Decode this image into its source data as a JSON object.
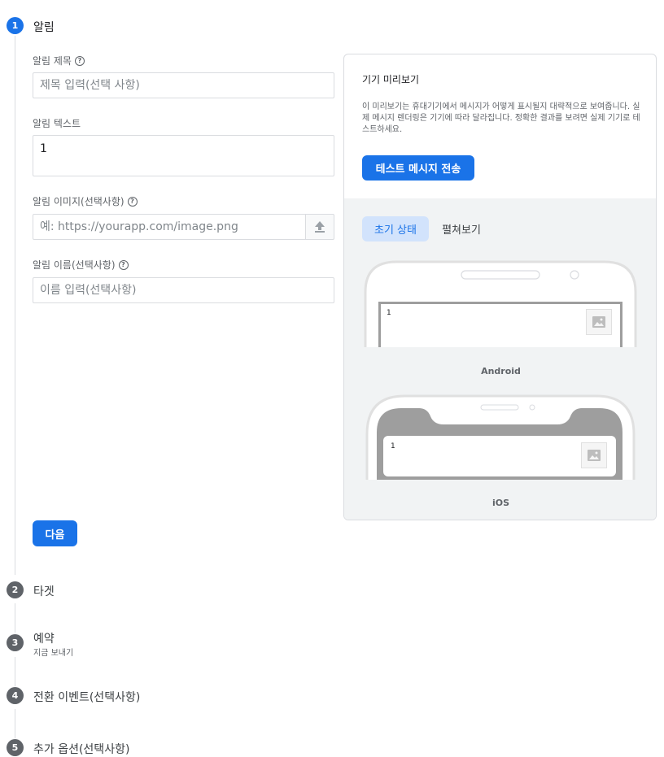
{
  "steps": [
    {
      "number": "1",
      "title": "알림"
    },
    {
      "number": "2",
      "title": "타겟"
    },
    {
      "number": "3",
      "title": "예약",
      "subtitle": "지금 보내기"
    },
    {
      "number": "4",
      "title": "전환 이벤트(선택사항)"
    },
    {
      "number": "5",
      "title": "추가 옵션(선택사항)"
    }
  ],
  "form": {
    "title_label": "알림 제목",
    "title_placeholder": "제목 입력(선택 사항)",
    "text_label": "알림 텍스트",
    "text_value": "1",
    "image_label": "알림 이미지(선택사항)",
    "image_placeholder": "예: https://yourapp.com/image.png",
    "name_label": "알림 이름(선택사항)",
    "name_placeholder": "이름 입력(선택사항)",
    "next_button": "다음"
  },
  "preview": {
    "title": "기기 미리보기",
    "description": "이 미리보기는 휴대기기에서 메시지가 어떻게 표시될지 대략적으로 보여줍니다. 실제 메시지 렌더링은 기기에 따라 달라집니다. 정확한 결과를 보려면 실제 기기로 테스트하세요.",
    "test_button": "테스트 메시지 전송",
    "tabs": [
      "초기 상태",
      "펼쳐보기"
    ],
    "selected_tab": "초기 상태",
    "android_label": "Android",
    "ios_label": "iOS",
    "notification_text": "1"
  },
  "icons": {
    "help": "help-circle-icon",
    "upload": "upload-icon",
    "image": "image-icon"
  },
  "colors": {
    "primary": "#1a73e8",
    "step_inactive": "#5f6368",
    "chip_selected_bg": "#d2e3fc",
    "preview_bg": "#f1f3f4"
  }
}
